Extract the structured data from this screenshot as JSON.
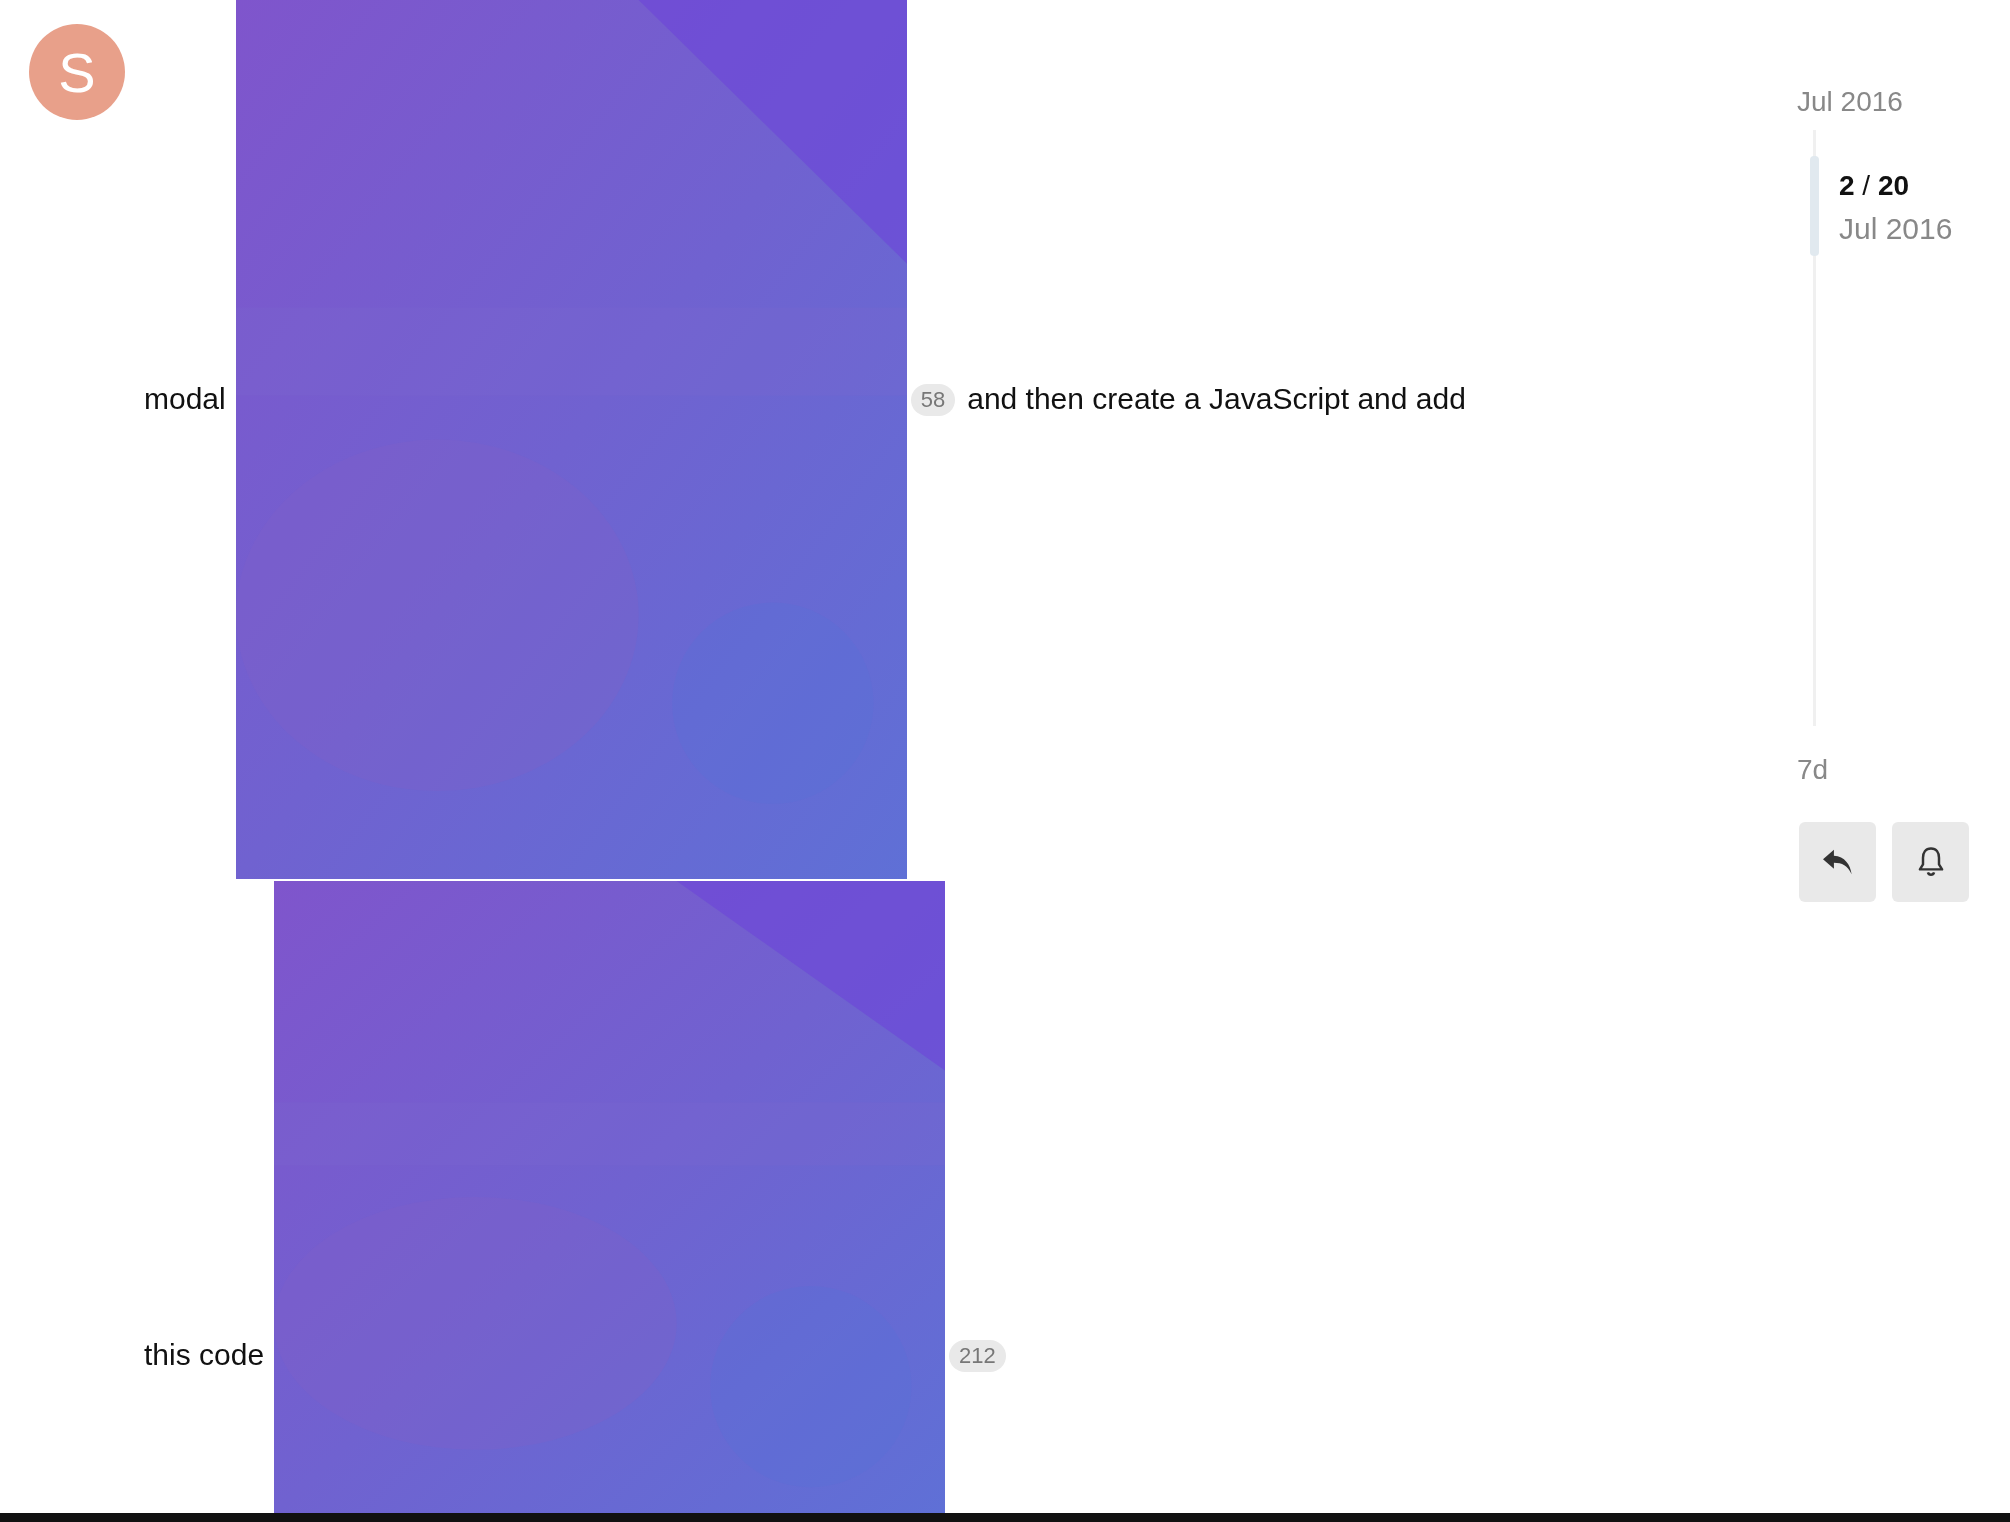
{
  "avatar": {
    "letter": "S"
  },
  "lines": [
    {
      "before": "modal",
      "count": "58",
      "after": "and then create a JavaScript and add"
    },
    {
      "before": "this code",
      "count": "212"
    }
  ],
  "timeline": {
    "start": "Jul 2016",
    "position": "**2** / **20**",
    "position_date": "Jul 2016",
    "end": "7d"
  },
  "buttons": [
    {
      "kind": "reply"
    },
    {
      "kind": "notifications"
    }
  ]
}
